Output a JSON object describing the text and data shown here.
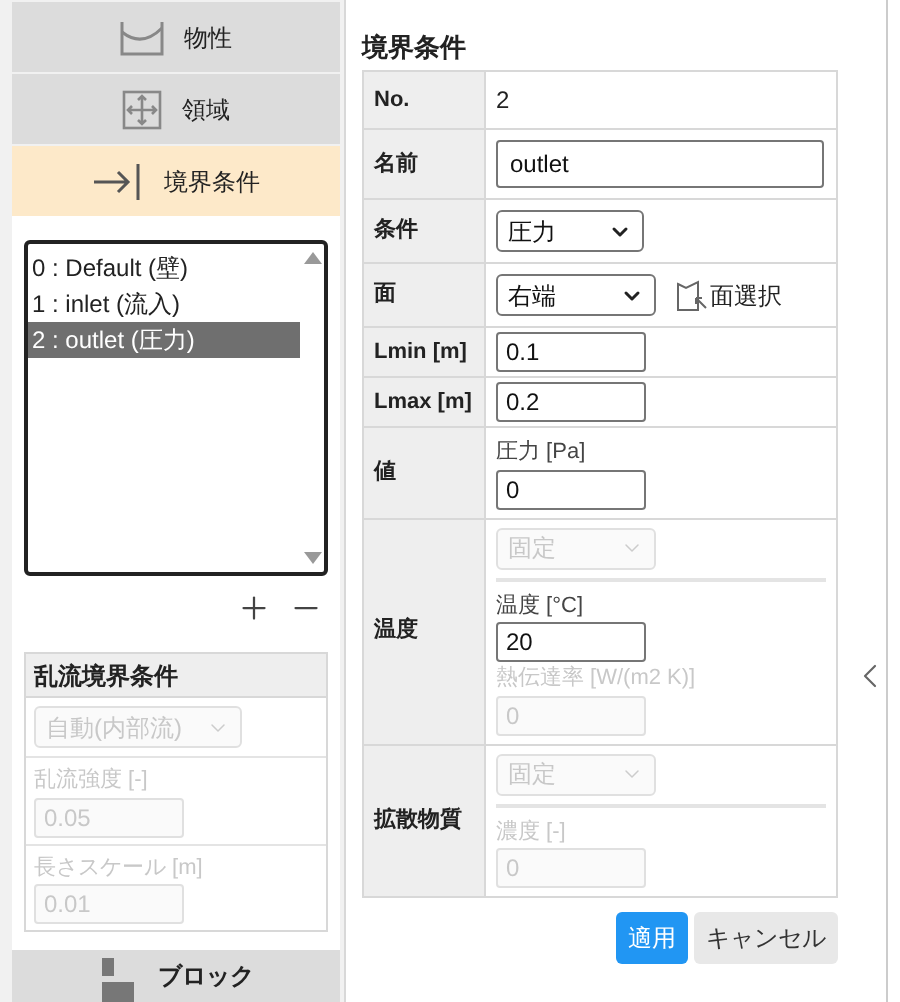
{
  "sidebar": {
    "tabs": [
      {
        "label": "物性",
        "selected": false
      },
      {
        "label": "領域",
        "selected": false
      },
      {
        "label": "境界条件",
        "selected": true
      }
    ],
    "boundary_list": {
      "items": [
        {
          "label": "0 : Default (壁)",
          "selected": false
        },
        {
          "label": "1 : inlet (流入)",
          "selected": false
        },
        {
          "label": "2 : outlet (圧力)",
          "selected": true
        }
      ]
    },
    "turbulence": {
      "title": "乱流境界条件",
      "mode": {
        "value": "自動(内部流)",
        "disabled": true
      },
      "fields": [
        {
          "label": "乱流強度 [-]",
          "value": "0.05",
          "disabled": true
        },
        {
          "label": "長さスケール [m]",
          "value": "0.01",
          "disabled": true
        }
      ]
    },
    "bottom_tab": {
      "label": "ブロック",
      "selected": false
    }
  },
  "panel": {
    "title": "境界条件",
    "rows": [
      {
        "label": "No.",
        "kind": "text",
        "value": "2"
      },
      {
        "label": "名前",
        "kind": "input",
        "value": "outlet"
      },
      {
        "label": "条件",
        "kind": "select",
        "value": "圧力"
      },
      {
        "label": "面",
        "kind": "face",
        "value": "右端",
        "button": "面選択"
      },
      {
        "label": "Lmin [m]",
        "kind": "small_input",
        "value": "0.1"
      },
      {
        "label": "Lmax [m]",
        "kind": "small_input",
        "value": "0.2"
      },
      {
        "label": "値",
        "kind": "group",
        "sections": [
          [
            {
              "kind": "input",
              "label": "圧力 [Pa]",
              "value": "0",
              "disabled": false
            }
          ]
        ]
      },
      {
        "label": "温度",
        "kind": "group",
        "sections": [
          [
            {
              "kind": "select",
              "value": "固定",
              "disabled": true
            }
          ],
          [
            {
              "kind": "input",
              "label": "温度 [°C]",
              "value": "20",
              "disabled": false
            },
            {
              "kind": "input",
              "label": "熱伝達率 [W/(m2 K)]",
              "value": "0",
              "disabled": true
            }
          ]
        ]
      },
      {
        "label": "拡散物質",
        "kind": "group",
        "sections": [
          [
            {
              "kind": "select",
              "value": "固定",
              "disabled": true
            }
          ],
          [
            {
              "kind": "input",
              "label": "濃度 [-]",
              "value": "0",
              "disabled": true
            }
          ]
        ]
      }
    ],
    "buttons": [
      {
        "label": "適用",
        "kind": "primary"
      },
      {
        "label": "キャンセル",
        "kind": "secondary"
      }
    ]
  }
}
